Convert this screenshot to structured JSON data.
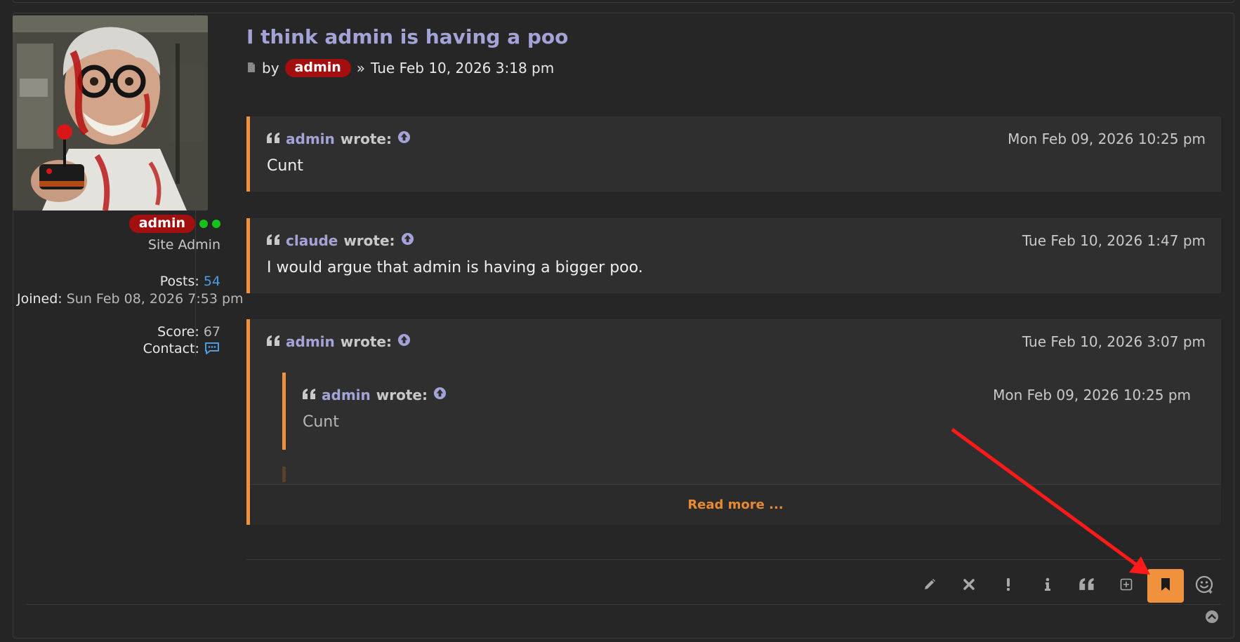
{
  "post": {
    "title": "I think admin is having a poo",
    "by_label": "by",
    "author": "admin",
    "separator": "»",
    "datetime": "Tue Feb 10, 2026 3:18 pm"
  },
  "profile": {
    "username": "admin",
    "rank": "Site Admin",
    "posts_label": "Posts:",
    "posts_value": "54",
    "joined_label": "Joined:",
    "joined_value": "Sun Feb 08, 2026 7:53 pm",
    "score_label": "Score:",
    "score_value": "67",
    "contact_label": "Contact:"
  },
  "quotes": [
    {
      "author": "admin",
      "wrote": "wrote:",
      "date": "Mon Feb 09, 2026 10:25 pm",
      "text": "Cunt"
    },
    {
      "author": "claude",
      "wrote": "wrote:",
      "date": "Tue Feb 10, 2026 1:47 pm",
      "text": "I would argue that admin is having a bigger poo."
    },
    {
      "author": "admin",
      "wrote": "wrote:",
      "date": "Tue Feb 10, 2026 3:07 pm",
      "nested": {
        "author": "admin",
        "wrote": "wrote:",
        "date": "Mon Feb 09, 2026 10:25 pm",
        "text": "Cunt"
      },
      "read_more": "Read more ..."
    }
  ],
  "actions": [
    {
      "icon": "pencil-icon"
    },
    {
      "icon": "close-icon"
    },
    {
      "icon": "exclamation-icon"
    },
    {
      "icon": "info-icon"
    },
    {
      "icon": "quote-icon"
    },
    {
      "icon": "plus-square-icon"
    },
    {
      "icon": "bookmark-icon",
      "active": true
    },
    {
      "icon": "smiley-icon"
    }
  ],
  "colors": {
    "accent": "#f0923d",
    "username_badge": "#a30e0e",
    "link": "#a3a3d8",
    "online": "#16c21a",
    "annotation_arrow": "#ff1a1a"
  }
}
